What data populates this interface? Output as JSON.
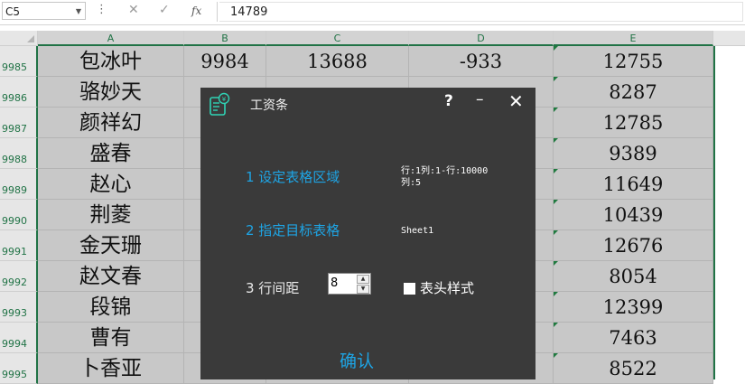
{
  "formula_bar": {
    "name_box": "C5",
    "fx_label": "fx",
    "cancel_glyph": "✕",
    "enter_glyph": "✓",
    "formula_value": "14789"
  },
  "columns": [
    "A",
    "B",
    "C",
    "D",
    "E"
  ],
  "rows": [
    {
      "num": "9985",
      "a": "包冰叶",
      "b": "9984",
      "c": "13688",
      "d": "-933",
      "e": "12755"
    },
    {
      "num": "9986",
      "a": "骆妙天",
      "b": "",
      "c": "",
      "d": "",
      "e": "8287"
    },
    {
      "num": "9987",
      "a": "颜祥幻",
      "b": "",
      "c": "",
      "d": "",
      "e": "12785"
    },
    {
      "num": "9988",
      "a": "盛春",
      "b": "",
      "c": "",
      "d": "",
      "e": "9389"
    },
    {
      "num": "9989",
      "a": "赵心",
      "b": "",
      "c": "",
      "d": "",
      "e": "11649"
    },
    {
      "num": "9990",
      "a": "荆菱",
      "b": "",
      "c": "",
      "d": "",
      "e": "10439"
    },
    {
      "num": "9991",
      "a": "金天珊",
      "b": "",
      "c": "",
      "d": "",
      "e": "12676"
    },
    {
      "num": "9992",
      "a": "赵文春",
      "b": "",
      "c": "",
      "d": "",
      "e": "8054"
    },
    {
      "num": "9993",
      "a": "段锦",
      "b": "",
      "c": "",
      "d": "",
      "e": "12399"
    },
    {
      "num": "9994",
      "a": "曹有",
      "b": "",
      "c": "",
      "d": "",
      "e": "7463"
    },
    {
      "num": "9995",
      "a": "卜香亚",
      "b": "",
      "c": "",
      "d": "",
      "e": "8522"
    }
  ],
  "dialog": {
    "title": "工资条",
    "help": "?",
    "minimize": "–",
    "close": "✕",
    "step1_label": "1 设定表格区域",
    "step1_info_line1": "行:1列:1-行:10000",
    "step1_info_line2": "列:5",
    "step2_label": "2 指定目标表格",
    "step2_info": "Sheet1",
    "step3_label": "3 行间距",
    "spacing_value": "8",
    "header_style_label": "表头样式",
    "confirm_label": "确认"
  },
  "colors": {
    "accent_green": "#217346",
    "dialog_bg": "#3a3a3a",
    "dialog_accent": "#1ea4e4",
    "selection_gray": "#c8c8c8"
  }
}
